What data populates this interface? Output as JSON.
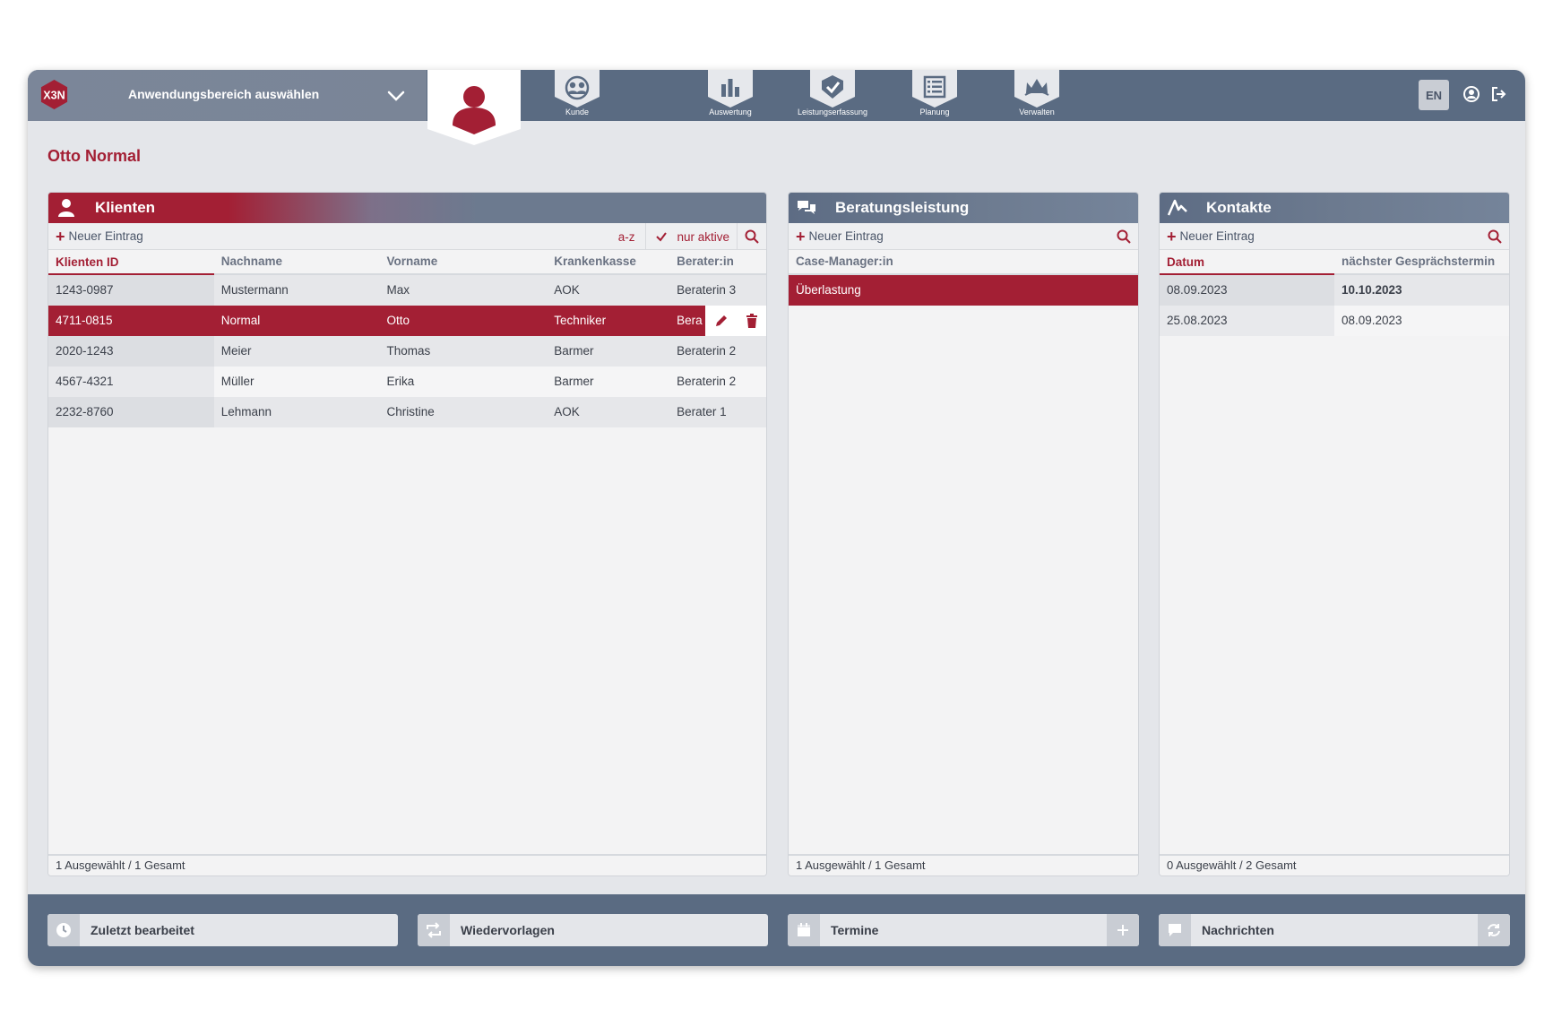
{
  "topbar": {
    "logo_text": "X3N",
    "area_select_label": "Anwendungsbereich auswählen",
    "nav": [
      {
        "label": "Kunde"
      },
      {
        "label": "Auswertung"
      },
      {
        "label": "Leistungserfassung"
      },
      {
        "label": "Planung"
      },
      {
        "label": "Verwalten"
      }
    ],
    "lang": "EN"
  },
  "page": {
    "title": "Otto Normal"
  },
  "klienten": {
    "title": "Klienten",
    "new_entry": "Neuer Eintrag",
    "sort_label": "a-z",
    "filter_label": "nur aktive",
    "columns": [
      "Klienten ID",
      "Nachname",
      "Vorname",
      "Krankenkasse",
      "Berater:in"
    ],
    "rows": [
      [
        "1243-0987",
        "Mustermann",
        "Max",
        "AOK",
        "Beraterin 3"
      ],
      [
        "4711-0815",
        "Normal",
        "Otto",
        "Techniker",
        "Bera"
      ],
      [
        "2020-1243",
        "Meier",
        "Thomas",
        "Barmer",
        "Beraterin 2"
      ],
      [
        "4567-4321",
        "Müller",
        "Erika",
        "Barmer",
        "Beraterin 2"
      ],
      [
        "2232-8760",
        "Lehmann",
        "Christine",
        "AOK",
        "Berater 1"
      ]
    ],
    "footer": "1 Ausgewählt / 1 Gesamt"
  },
  "beratung": {
    "title": "Beratungsleistung",
    "new_entry": "Neuer Eintrag",
    "columns": [
      "Case-Manager:in"
    ],
    "rows": [
      [
        "Überlastung"
      ]
    ],
    "footer": "1 Ausgewählt / 1 Gesamt"
  },
  "kontakte": {
    "title": "Kontakte",
    "new_entry": "Neuer Eintrag",
    "columns": [
      "Datum",
      "nächster Gesprächstermin"
    ],
    "rows": [
      [
        "08.09.2023",
        "10.10.2023"
      ],
      [
        "25.08.2023",
        "08.09.2023"
      ]
    ],
    "footer": "0 Ausgewählt / 2 Gesamt"
  },
  "bottombar": {
    "recent": "Zuletzt bearbeitet",
    "followups": "Wiedervorlagen",
    "appointments": "Termine",
    "messages": "Nachrichten"
  },
  "colors": {
    "accent": "#a31f34",
    "bar": "#5a6b82",
    "panel_head": "#6c7a8f"
  },
  "icons": {
    "logo": "x3n-logo",
    "area": "chevron-down-icon",
    "user": "user-icon",
    "nav": [
      "customer-group-icon",
      "bar-chart-icon",
      "checkmark-shield-icon",
      "list-icon",
      "crown-icon"
    ],
    "top_right": [
      "account-icon",
      "logout-icon"
    ],
    "panels": [
      "user-icon",
      "chat-bubbles-icon",
      "activity-icon"
    ],
    "bottom": [
      "clock-icon",
      "repeat-icon",
      "calendar-icon",
      "message-icon",
      "plus-icon",
      "refresh-icon"
    ]
  }
}
